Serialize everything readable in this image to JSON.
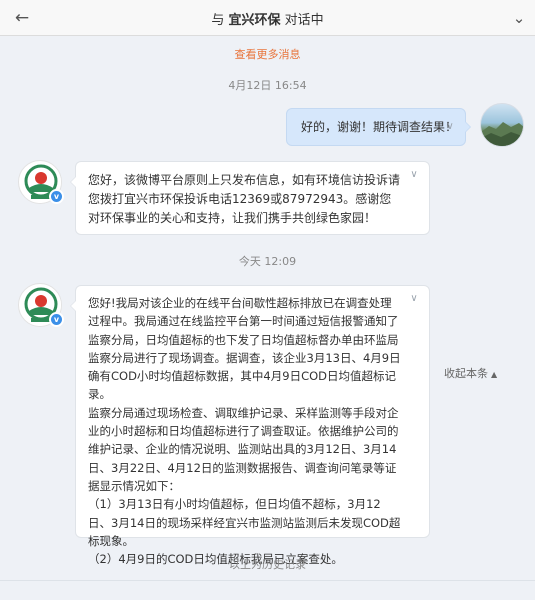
{
  "header": {
    "prefix": "与",
    "name": "宜兴环保",
    "suffix": "对话中",
    "back_icon": "back-arrow-icon",
    "menu_icon": "chevron-down-icon"
  },
  "load_more": "查看更多消息",
  "timestamps": {
    "first": "4月12日 16:54",
    "second": "今天 12:09"
  },
  "messages": {
    "outgoing": {
      "text": "好的，谢谢！期待调查结果！"
    },
    "reply1": {
      "text": "您好，该微博平台原则上只发布信息，如有环境信访投诉请您拨打宜兴市环保投诉电话12369或87972943。感谢您对环保事业的关心和支持，让我们携手共创绿色家园！"
    },
    "reply2": {
      "paragraphs": [
        "您好!我局对该企业的在线平台间歇性超标排放已在调查处理过程中。我局通过在线监控平台第一时间通过短信报警通知了监察分局，日均值超标的也下发了日均值超标督办单由环监局监察分局进行了现场调查。据调查，该企业3月13日、4月9日确有COD小时均值超标数据，其中4月9日COD日均值超标记录。",
        "监察分局通过现场检查、调取维护记录、采样监测等手段对企业的小时超标和日均值超标进行了调查取证。依据维护公司的维护记录、企业的情况说明、监测站出具的3月12日、3月14日、3月22日、4月12日的监测数据报告、调查询问笔录等证据显示情况如下：",
        "（1）3月13日有小时均值超标，但日均值不超标，3月12日、3月14日的现场采样经宜兴市监测站监测后未发现COD超标现象。",
        "（2）4月9日的COD日均值超标我局已立案查处。"
      ]
    }
  },
  "collapse_label": "收起本条",
  "history_label": "以上为历史记录",
  "colors": {
    "accent_orange": "#e8743b",
    "verified_blue": "#3b8fe8",
    "outgoing_bubble": "#d6e7fb"
  }
}
